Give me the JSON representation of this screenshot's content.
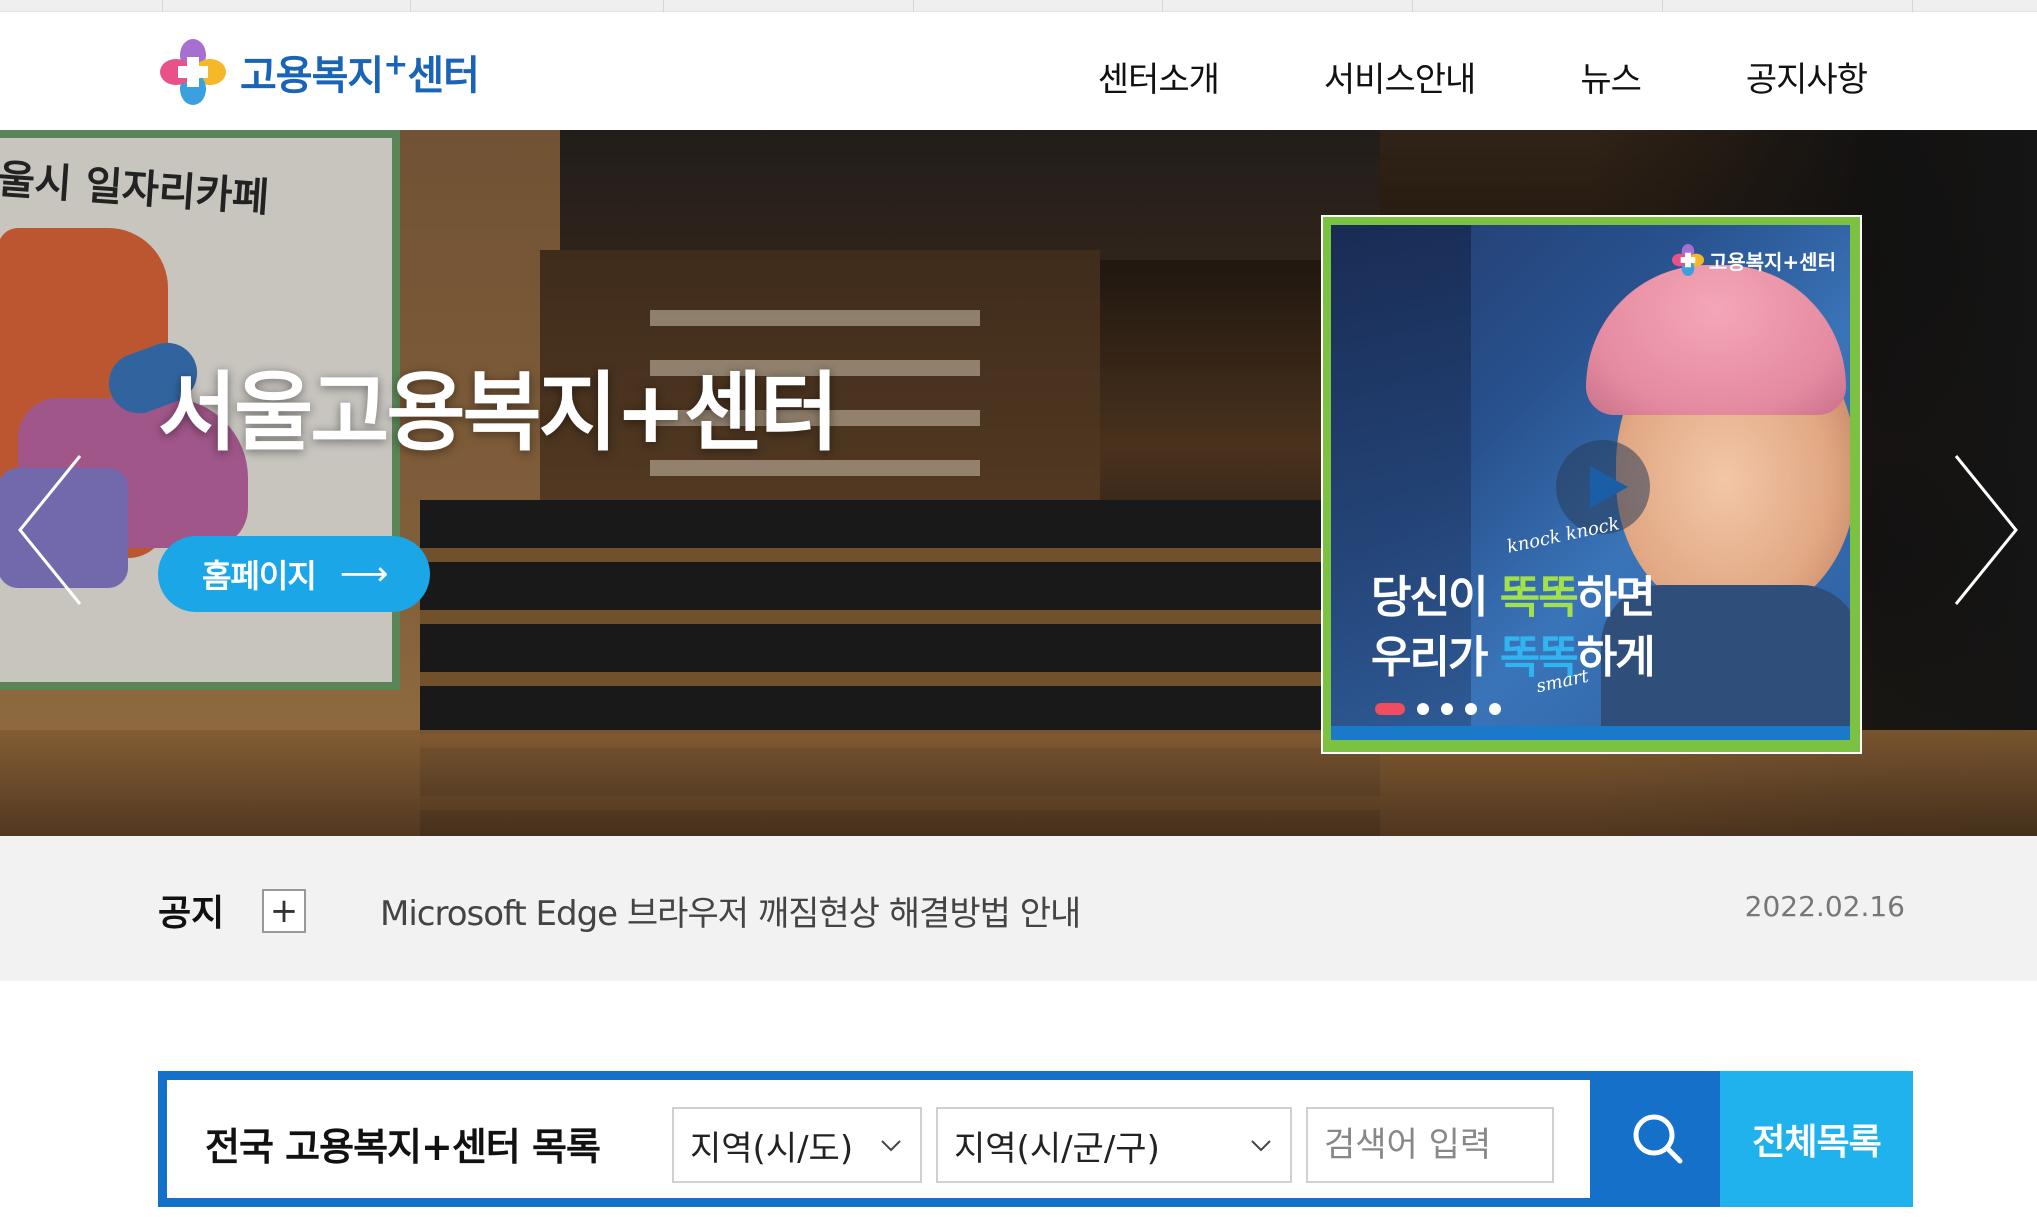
{
  "header": {
    "logo_text": "고용복지",
    "logo_plus": "+",
    "logo_suffix": "센터",
    "nav": [
      "센터소개",
      "서비스안내",
      "뉴스",
      "공지사항"
    ]
  },
  "hero": {
    "title": "서울고용복지+센터",
    "button_label": "홈페이지",
    "button_arrow": "⟶",
    "map_title": "울시 일자리카페"
  },
  "promo": {
    "logo_text": "고용복지+센터",
    "line1_a": "당신이 ",
    "line1_hl": "똑똑",
    "line1_b": "하면",
    "line2_a": "우리가 ",
    "line2_hl": "똑똑",
    "line2_b": "하게",
    "knock": "knock knock",
    "smart": "smart",
    "slide_count": 5,
    "active_slide": 1
  },
  "notice": {
    "label": "공지",
    "plus": "+",
    "text": "Microsoft Edge 브라우저 깨짐현상 해결방법 안내",
    "date": "2022.02.16"
  },
  "search": {
    "title": "전국 고용복지+센터 목록",
    "select_region": "지역(시/도)",
    "select_district": "지역(시/군/구)",
    "keyword_placeholder": "검색어 입력",
    "all_list_label": "전체목록"
  },
  "colors": {
    "brand_blue": "#1570c9",
    "accent_sky": "#1fb2ec",
    "hero_button": "#1ba6e8",
    "promo_green": "#a3e04b",
    "promo_red_dot": "#f04e5e"
  }
}
